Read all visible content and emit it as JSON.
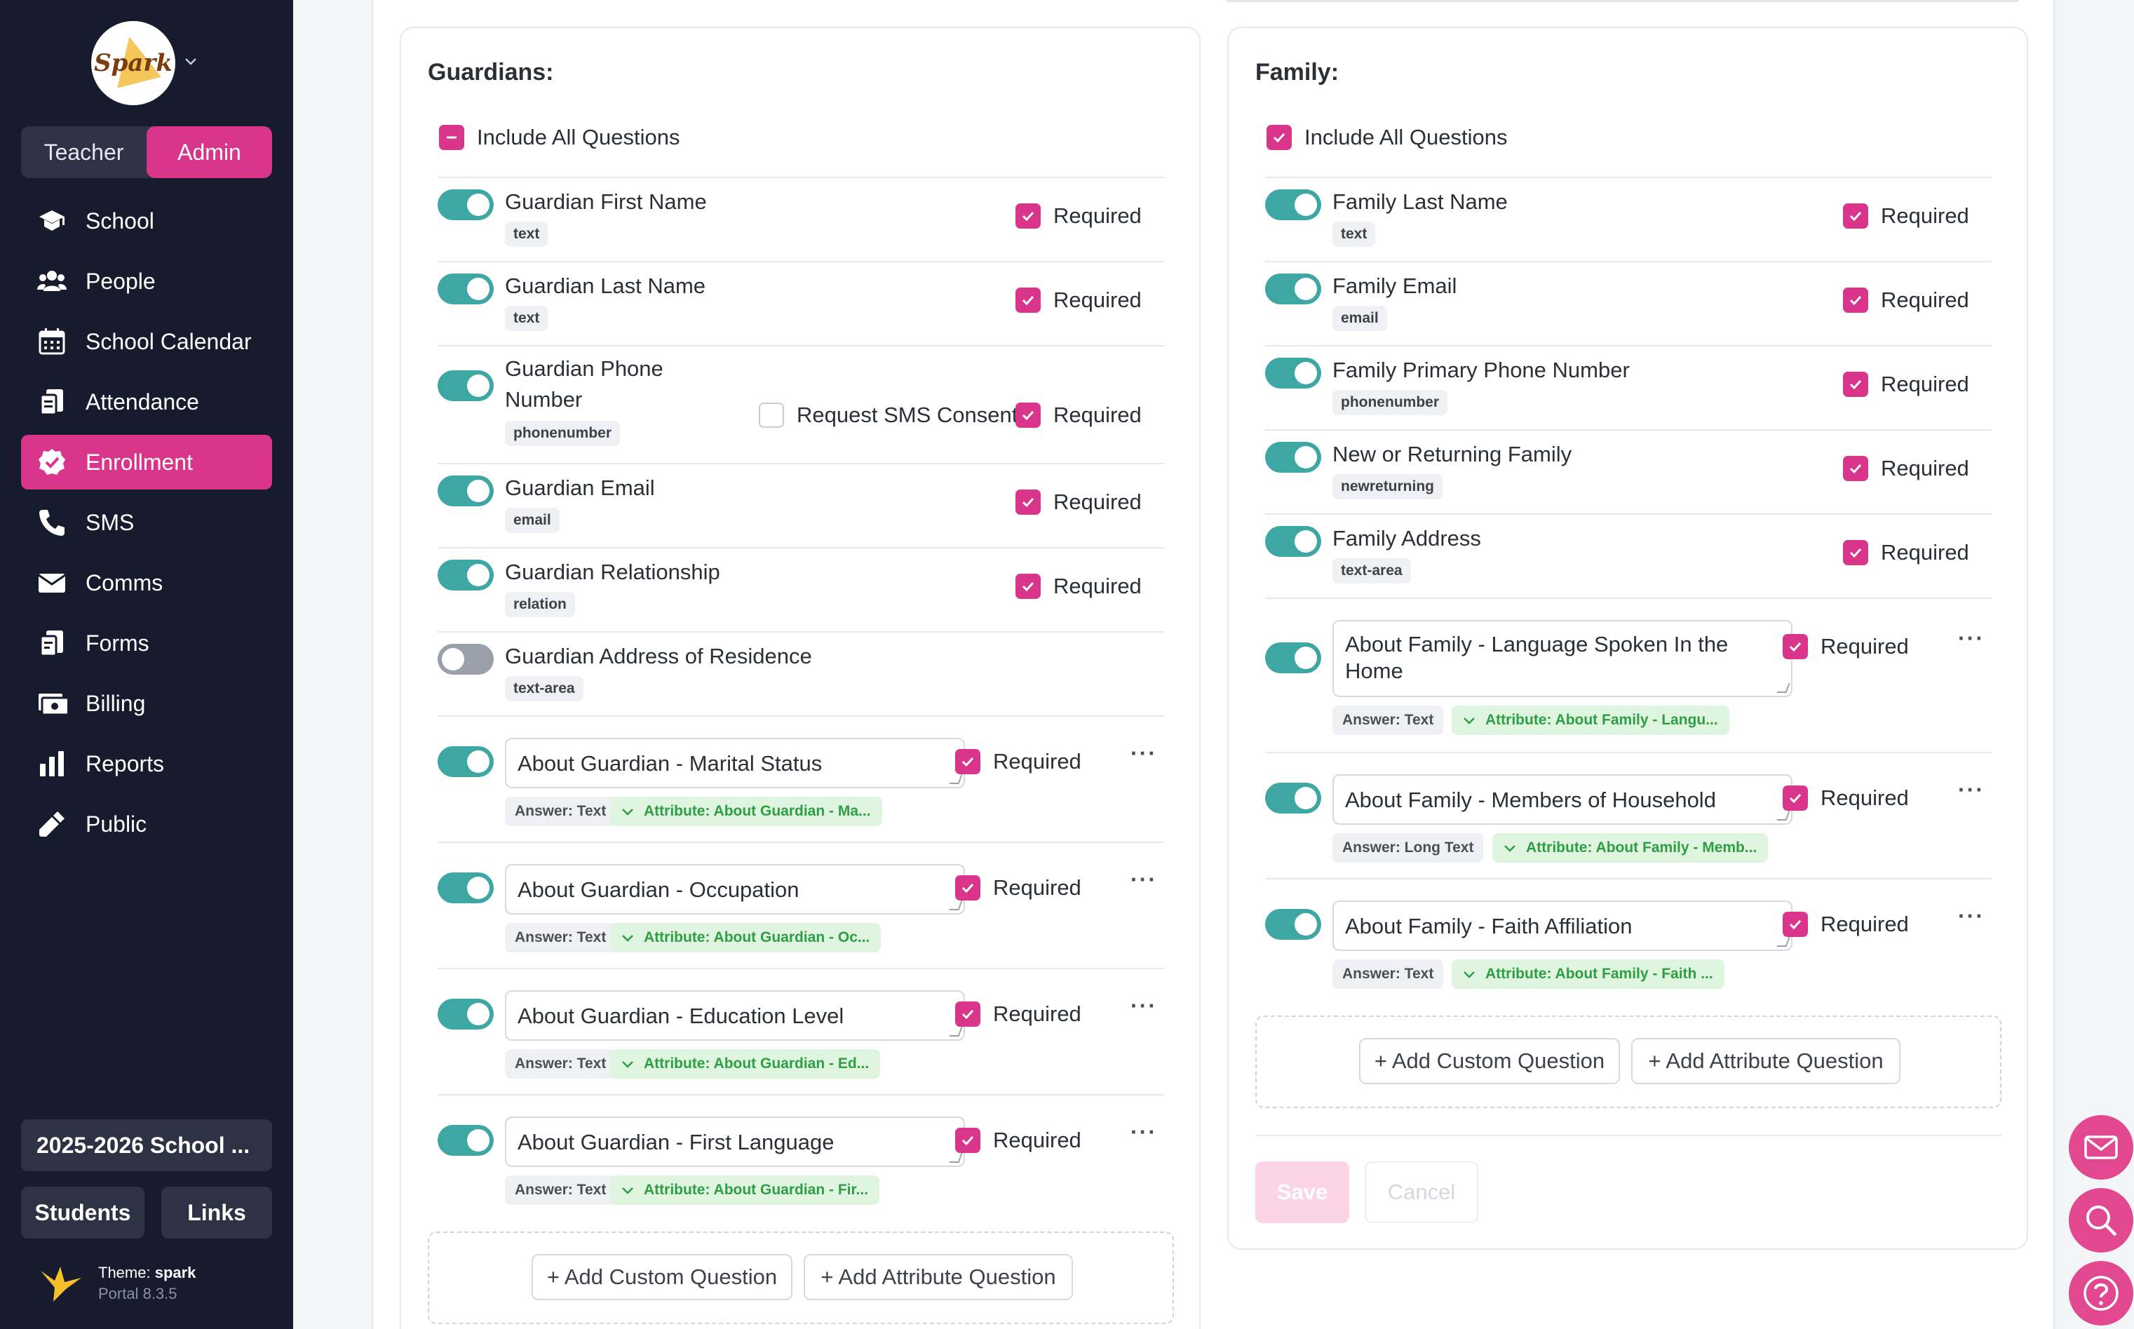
{
  "sidebar": {
    "logo_text": "Spark",
    "roles": {
      "teacher": "Teacher",
      "admin": "Admin"
    },
    "nav": [
      {
        "label": "School",
        "icon": "graduation-cap-icon"
      },
      {
        "label": "People",
        "icon": "people-icon"
      },
      {
        "label": "School Calendar",
        "icon": "calendar-icon"
      },
      {
        "label": "Attendance",
        "icon": "clipboard-icon"
      },
      {
        "label": "Enrollment",
        "icon": "check-badge-icon"
      },
      {
        "label": "SMS",
        "icon": "phone-icon"
      },
      {
        "label": "Comms",
        "icon": "envelope-icon"
      },
      {
        "label": "Forms",
        "icon": "forms-icon"
      },
      {
        "label": "Billing",
        "icon": "billing-icon"
      },
      {
        "label": "Reports",
        "icon": "bar-chart-icon"
      },
      {
        "label": "Public",
        "icon": "dropper-icon"
      }
    ],
    "school_year": "2025-2026 School ...",
    "students": "Students",
    "links": "Links",
    "theme_label": "Theme: ",
    "theme_name": "spark",
    "portal_version": "Portal 8.3.5"
  },
  "guardians": {
    "title": "Guardians:",
    "include_all": "Include All Questions",
    "required": "Required",
    "request_sms": "Request SMS Consent",
    "fields": [
      {
        "label": "Guardian First Name",
        "type": "text"
      },
      {
        "label": "Guardian Last Name",
        "type": "text"
      },
      {
        "label_line1": "Guardian Phone",
        "label_line2": "Number",
        "type": "phonenumber"
      },
      {
        "label": "Guardian Email",
        "type": "email"
      },
      {
        "label": "Guardian Relationship",
        "type": "relation"
      },
      {
        "label": "Guardian Address of Residence",
        "type": "text-area"
      }
    ],
    "custom": [
      {
        "value": "About Guardian - Marital Status",
        "answer": "Answer: Text",
        "attribute": "Attribute: About Guardian - Ma..."
      },
      {
        "value": "About Guardian - Occupation",
        "answer": "Answer: Text",
        "attribute": "Attribute: About Guardian - Oc..."
      },
      {
        "value": "About Guardian - Education Level",
        "answer": "Answer: Text",
        "attribute": "Attribute: About Guardian - Ed..."
      },
      {
        "value": "About Guardian - First Language",
        "answer": "Answer: Text",
        "attribute": "Attribute: About Guardian - Fir..."
      }
    ],
    "add_custom": "+ Add Custom Question",
    "add_attribute": "+ Add Attribute Question"
  },
  "family": {
    "title": "Family:",
    "include_all": "Include All Questions",
    "required": "Required",
    "fields": [
      {
        "label": "Family Last Name",
        "type": "text"
      },
      {
        "label": "Family Email",
        "type": "email"
      },
      {
        "label": "Family Primary Phone Number",
        "type": "phonenumber"
      },
      {
        "label": "New or Returning Family",
        "type": "newreturning"
      },
      {
        "label": "Family Address",
        "type": "text-area"
      }
    ],
    "custom": [
      {
        "value_line1": "About Family - Language Spoken In the",
        "value_line2": "Home",
        "answer": "Answer: Text",
        "attribute": "Attribute: About Family - Langu..."
      },
      {
        "value": "About Family - Members of Household",
        "answer": "Answer: Long Text",
        "attribute": "Attribute: About Family - Memb..."
      },
      {
        "value": "About Family - Faith Affiliation",
        "answer": "Answer: Text",
        "attribute": "Attribute: About Family - Faith ..."
      }
    ],
    "add_custom": "+ Add Custom Question",
    "add_attribute": "+ Add Attribute Question",
    "save": "Save",
    "cancel": "Cancel"
  },
  "fabs": [
    "envelope-icon",
    "search-icon",
    "help-icon"
  ],
  "colors": {
    "accent": "#d9358b",
    "toggle_on": "#3fa7a3",
    "sidebar": "#161b2e",
    "attribute_green": "#2e9e44"
  }
}
